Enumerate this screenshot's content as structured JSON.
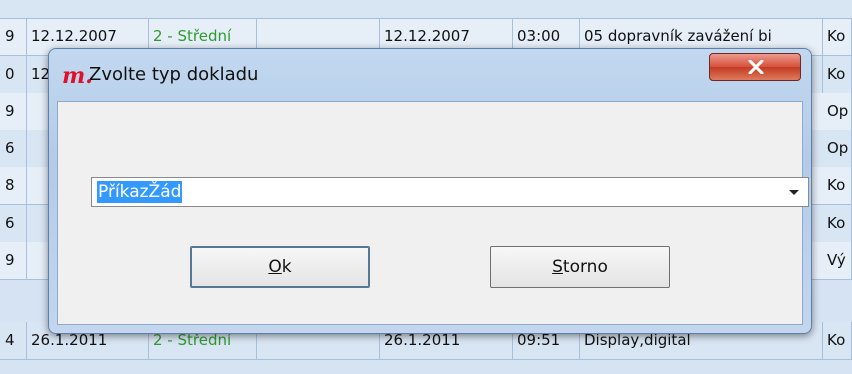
{
  "grid": {
    "rows": [
      {
        "c0": "9",
        "c1": "12.12.2007",
        "c2": "2 - Střední",
        "c3": "",
        "c4": "12.12.2007",
        "c5": "03:00",
        "c6": "05 dopravník zavážení bi",
        "c7": "Ko"
      },
      {
        "c0": "0",
        "c1": "12",
        "c2": "",
        "c3": "",
        "c4": "",
        "c5": "",
        "c6": "",
        "c7": "Ko"
      },
      {
        "c0": "9",
        "c1": "",
        "c2": "",
        "c3": "",
        "c4": "",
        "c5": "",
        "c6": "",
        "c7": "Op"
      },
      {
        "c0": "6",
        "c1": "",
        "c2": "",
        "c3": "",
        "c4": "",
        "c5": "",
        "c6": "",
        "c7": "Op"
      },
      {
        "c0": "8",
        "c1": "",
        "c2": "",
        "c3": "",
        "c4": "",
        "c5": "",
        "c6": "",
        "c7": "Ko"
      },
      {
        "c0": "6",
        "c1": "",
        "c2": "",
        "c3": "",
        "c4": "",
        "c5": "",
        "c6": "",
        "c7": "Ko"
      },
      {
        "c0": "9",
        "c1": "",
        "c2": "",
        "c3": "",
        "c4": "",
        "c5": "",
        "c6": "",
        "c7": "Vý"
      },
      {
        "c0": "4",
        "c1": "26.1.2011",
        "c2": "2 - Střední",
        "c3": "",
        "c4": "26.1.2011",
        "c5": "09:51",
        "c6": "Display,digital",
        "c7": "Ko"
      }
    ]
  },
  "dialog": {
    "logo_text": "m.",
    "title": "Zvolte typ dokladu",
    "close_icon": "close-x-icon",
    "select_value": "PříkazŽád",
    "ok_accel": "O",
    "ok_rest": "k",
    "storno_accel": "S",
    "storno_rest": "torno"
  },
  "colors": {
    "priority_green": "#2f9b2f",
    "close_red": "#d6503a",
    "selection_blue": "#3399ff"
  }
}
